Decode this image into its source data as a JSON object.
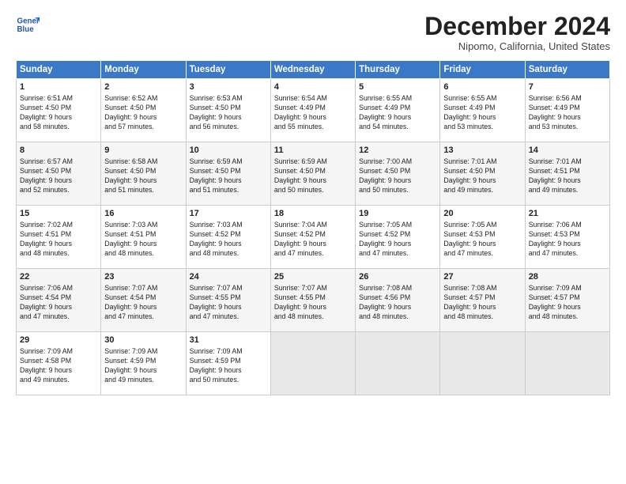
{
  "header": {
    "logo_line1": "General",
    "logo_line2": "Blue",
    "month_title": "December 2024",
    "subtitle": "Nipomo, California, United States"
  },
  "days_of_week": [
    "Sunday",
    "Monday",
    "Tuesday",
    "Wednesday",
    "Thursday",
    "Friday",
    "Saturday"
  ],
  "weeks": [
    [
      {
        "day": 1,
        "lines": [
          "Sunrise: 6:51 AM",
          "Sunset: 4:50 PM",
          "Daylight: 9 hours",
          "and 58 minutes."
        ]
      },
      {
        "day": 2,
        "lines": [
          "Sunrise: 6:52 AM",
          "Sunset: 4:50 PM",
          "Daylight: 9 hours",
          "and 57 minutes."
        ]
      },
      {
        "day": 3,
        "lines": [
          "Sunrise: 6:53 AM",
          "Sunset: 4:50 PM",
          "Daylight: 9 hours",
          "and 56 minutes."
        ]
      },
      {
        "day": 4,
        "lines": [
          "Sunrise: 6:54 AM",
          "Sunset: 4:49 PM",
          "Daylight: 9 hours",
          "and 55 minutes."
        ]
      },
      {
        "day": 5,
        "lines": [
          "Sunrise: 6:55 AM",
          "Sunset: 4:49 PM",
          "Daylight: 9 hours",
          "and 54 minutes."
        ]
      },
      {
        "day": 6,
        "lines": [
          "Sunrise: 6:55 AM",
          "Sunset: 4:49 PM",
          "Daylight: 9 hours",
          "and 53 minutes."
        ]
      },
      {
        "day": 7,
        "lines": [
          "Sunrise: 6:56 AM",
          "Sunset: 4:49 PM",
          "Daylight: 9 hours",
          "and 53 minutes."
        ]
      }
    ],
    [
      {
        "day": 8,
        "lines": [
          "Sunrise: 6:57 AM",
          "Sunset: 4:50 PM",
          "Daylight: 9 hours",
          "and 52 minutes."
        ]
      },
      {
        "day": 9,
        "lines": [
          "Sunrise: 6:58 AM",
          "Sunset: 4:50 PM",
          "Daylight: 9 hours",
          "and 51 minutes."
        ]
      },
      {
        "day": 10,
        "lines": [
          "Sunrise: 6:59 AM",
          "Sunset: 4:50 PM",
          "Daylight: 9 hours",
          "and 51 minutes."
        ]
      },
      {
        "day": 11,
        "lines": [
          "Sunrise: 6:59 AM",
          "Sunset: 4:50 PM",
          "Daylight: 9 hours",
          "and 50 minutes."
        ]
      },
      {
        "day": 12,
        "lines": [
          "Sunrise: 7:00 AM",
          "Sunset: 4:50 PM",
          "Daylight: 9 hours",
          "and 50 minutes."
        ]
      },
      {
        "day": 13,
        "lines": [
          "Sunrise: 7:01 AM",
          "Sunset: 4:50 PM",
          "Daylight: 9 hours",
          "and 49 minutes."
        ]
      },
      {
        "day": 14,
        "lines": [
          "Sunrise: 7:01 AM",
          "Sunset: 4:51 PM",
          "Daylight: 9 hours",
          "and 49 minutes."
        ]
      }
    ],
    [
      {
        "day": 15,
        "lines": [
          "Sunrise: 7:02 AM",
          "Sunset: 4:51 PM",
          "Daylight: 9 hours",
          "and 48 minutes."
        ]
      },
      {
        "day": 16,
        "lines": [
          "Sunrise: 7:03 AM",
          "Sunset: 4:51 PM",
          "Daylight: 9 hours",
          "and 48 minutes."
        ]
      },
      {
        "day": 17,
        "lines": [
          "Sunrise: 7:03 AM",
          "Sunset: 4:52 PM",
          "Daylight: 9 hours",
          "and 48 minutes."
        ]
      },
      {
        "day": 18,
        "lines": [
          "Sunrise: 7:04 AM",
          "Sunset: 4:52 PM",
          "Daylight: 9 hours",
          "and 47 minutes."
        ]
      },
      {
        "day": 19,
        "lines": [
          "Sunrise: 7:05 AM",
          "Sunset: 4:52 PM",
          "Daylight: 9 hours",
          "and 47 minutes."
        ]
      },
      {
        "day": 20,
        "lines": [
          "Sunrise: 7:05 AM",
          "Sunset: 4:53 PM",
          "Daylight: 9 hours",
          "and 47 minutes."
        ]
      },
      {
        "day": 21,
        "lines": [
          "Sunrise: 7:06 AM",
          "Sunset: 4:53 PM",
          "Daylight: 9 hours",
          "and 47 minutes."
        ]
      }
    ],
    [
      {
        "day": 22,
        "lines": [
          "Sunrise: 7:06 AM",
          "Sunset: 4:54 PM",
          "Daylight: 9 hours",
          "and 47 minutes."
        ]
      },
      {
        "day": 23,
        "lines": [
          "Sunrise: 7:07 AM",
          "Sunset: 4:54 PM",
          "Daylight: 9 hours",
          "and 47 minutes."
        ]
      },
      {
        "day": 24,
        "lines": [
          "Sunrise: 7:07 AM",
          "Sunset: 4:55 PM",
          "Daylight: 9 hours",
          "and 47 minutes."
        ]
      },
      {
        "day": 25,
        "lines": [
          "Sunrise: 7:07 AM",
          "Sunset: 4:55 PM",
          "Daylight: 9 hours",
          "and 48 minutes."
        ]
      },
      {
        "day": 26,
        "lines": [
          "Sunrise: 7:08 AM",
          "Sunset: 4:56 PM",
          "Daylight: 9 hours",
          "and 48 minutes."
        ]
      },
      {
        "day": 27,
        "lines": [
          "Sunrise: 7:08 AM",
          "Sunset: 4:57 PM",
          "Daylight: 9 hours",
          "and 48 minutes."
        ]
      },
      {
        "day": 28,
        "lines": [
          "Sunrise: 7:09 AM",
          "Sunset: 4:57 PM",
          "Daylight: 9 hours",
          "and 48 minutes."
        ]
      }
    ],
    [
      {
        "day": 29,
        "lines": [
          "Sunrise: 7:09 AM",
          "Sunset: 4:58 PM",
          "Daylight: 9 hours",
          "and 49 minutes."
        ]
      },
      {
        "day": 30,
        "lines": [
          "Sunrise: 7:09 AM",
          "Sunset: 4:59 PM",
          "Daylight: 9 hours",
          "and 49 minutes."
        ]
      },
      {
        "day": 31,
        "lines": [
          "Sunrise: 7:09 AM",
          "Sunset: 4:59 PM",
          "Daylight: 9 hours",
          "and 50 minutes."
        ]
      },
      null,
      null,
      null,
      null
    ]
  ]
}
